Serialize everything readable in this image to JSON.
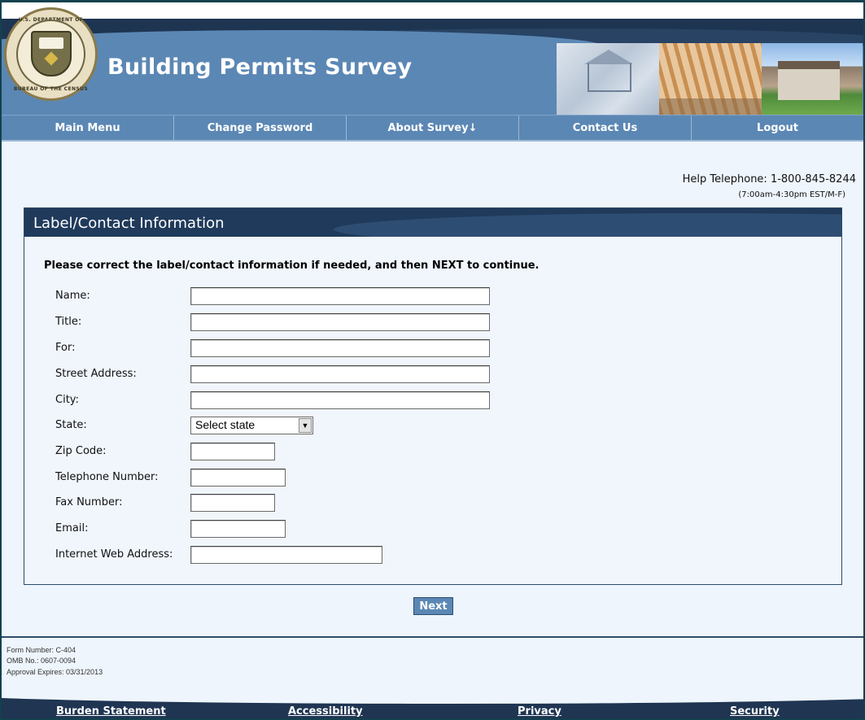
{
  "header": {
    "title": "Building Permits Survey",
    "seal": {
      "text_top": "U.S. DEPARTMENT OF COMMERCE",
      "text_bottom": "BUREAU OF THE CENSUS"
    }
  },
  "nav": {
    "items": [
      {
        "label": "Main Menu"
      },
      {
        "label": "Change Password"
      },
      {
        "label": "About Survey↓"
      },
      {
        "label": "Contact Us"
      },
      {
        "label": "Logout"
      }
    ]
  },
  "help": {
    "telephone": "Help Telephone: 1-800-845-8244",
    "hours": "(7:00am-4:30pm EST/M-F)"
  },
  "panel": {
    "title": "Label/Contact Information",
    "instructions": "Please correct the label/contact information if needed, and then NEXT to continue.",
    "fields": {
      "name": {
        "label": "Name:",
        "value": ""
      },
      "title": {
        "label": "Title:",
        "value": ""
      },
      "for": {
        "label": "For:",
        "value": ""
      },
      "street": {
        "label": "Street Address:",
        "value": ""
      },
      "city": {
        "label": "City:",
        "value": ""
      },
      "state": {
        "label": "State:",
        "selected": "Select state"
      },
      "zip": {
        "label": "Zip Code:",
        "value": ""
      },
      "telephone": {
        "label": "Telephone Number:",
        "value": ""
      },
      "fax": {
        "label": "Fax Number:",
        "value": ""
      },
      "email": {
        "label": "Email:",
        "value": ""
      },
      "web": {
        "label": "Internet Web Address:",
        "value": ""
      }
    }
  },
  "next_label": "Next",
  "form_meta": {
    "form_number": "Form Number: C-404",
    "omb": "OMB No.: 0607-0094",
    "approval": "Approval Expires: 03/31/2013"
  },
  "footer": {
    "links": [
      {
        "label": "Burden Statement"
      },
      {
        "label": "Accessibility"
      },
      {
        "label": "Privacy"
      },
      {
        "label": "Security"
      }
    ]
  },
  "colors": {
    "header_blue": "#5b87b4",
    "dark_navy": "#1f3a5b",
    "page_bg": "#eef5fc"
  }
}
